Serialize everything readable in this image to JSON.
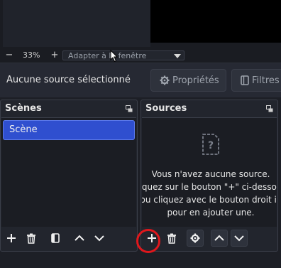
{
  "zoom": {
    "minus_label": "−",
    "percent": "33%",
    "plus_label": "+",
    "mode_value": "Adapter à la fenêtre"
  },
  "controls": {
    "no_source_label": "Aucune source sélectionné",
    "properties_label": "Propriétés",
    "filters_label": "Filtres"
  },
  "scenes": {
    "title": "Scènes",
    "items": [
      "Scène"
    ]
  },
  "sources": {
    "title": "Sources",
    "empty_lines": [
      "Vous n'avez aucune source.",
      "iquez sur le bouton \"+\" ci-dessou",
      "ou cliquez avec le bouton droit ic",
      "pour en ajouter une."
    ]
  },
  "colors": {
    "accent_selection": "#2f4fcf",
    "highlight_ring": "#e0171c"
  }
}
